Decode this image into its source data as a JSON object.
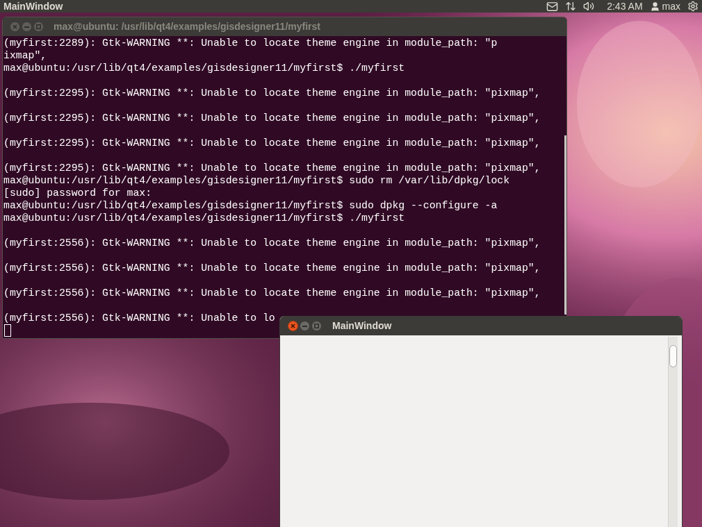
{
  "top_panel": {
    "app_title": "MainWindow",
    "clock": "2:43 AM",
    "user": "max"
  },
  "terminal": {
    "title": "max@ubuntu: /usr/lib/qt4/examples/gisdesigner11/myfirst",
    "active": false,
    "cursor": true,
    "lines": [
      {
        "kind": "output",
        "text": "(myfirst:2289): Gtk-WARNING **: Unable to locate theme engine in module_path: \"p"
      },
      {
        "kind": "output",
        "text": "ixmap\","
      },
      {
        "kind": "output",
        "text": "max@ubuntu:/usr/lib/qt4/examples/gisdesigner11/myfirst$ ./myfirst"
      },
      {
        "kind": "blank"
      },
      {
        "kind": "output",
        "text": "(myfirst:2295): Gtk-WARNING **: Unable to locate theme engine in module_path: \"pixmap\","
      },
      {
        "kind": "blank"
      },
      {
        "kind": "output",
        "text": "(myfirst:2295): Gtk-WARNING **: Unable to locate theme engine in module_path: \"pixmap\","
      },
      {
        "kind": "blank"
      },
      {
        "kind": "output",
        "text": "(myfirst:2295): Gtk-WARNING **: Unable to locate theme engine in module_path: \"pixmap\","
      },
      {
        "kind": "blank"
      },
      {
        "kind": "output",
        "text": "(myfirst:2295): Gtk-WARNING **: Unable to locate theme engine in module_path: \"pixmap\","
      },
      {
        "kind": "output",
        "text": "max@ubuntu:/usr/lib/qt4/examples/gisdesigner11/myfirst$ sudo rm /var/lib/dpkg/lock"
      },
      {
        "kind": "output",
        "text": "[sudo] password for max:"
      },
      {
        "kind": "output",
        "text": "max@ubuntu:/usr/lib/qt4/examples/gisdesigner11/myfirst$ sudo dpkg --configure -a"
      },
      {
        "kind": "output",
        "text": "max@ubuntu:/usr/lib/qt4/examples/gisdesigner11/myfirst$ ./myfirst"
      },
      {
        "kind": "blank"
      },
      {
        "kind": "output",
        "text": "(myfirst:2556): Gtk-WARNING **: Unable to locate theme engine in module_path: \"pixmap\","
      },
      {
        "kind": "blank"
      },
      {
        "kind": "output",
        "text": "(myfirst:2556): Gtk-WARNING **: Unable to locate theme engine in module_path: \"pixmap\","
      },
      {
        "kind": "blank"
      },
      {
        "kind": "output",
        "text": "(myfirst:2556): Gtk-WARNING **: Unable to locate theme engine in module_path: \"pixmap\","
      },
      {
        "kind": "blank"
      },
      {
        "kind": "output",
        "text": "(myfirst:2556): Gtk-WARNING **: Unable to lo"
      }
    ]
  },
  "main_window": {
    "title": "MainWindow",
    "active": true
  }
}
